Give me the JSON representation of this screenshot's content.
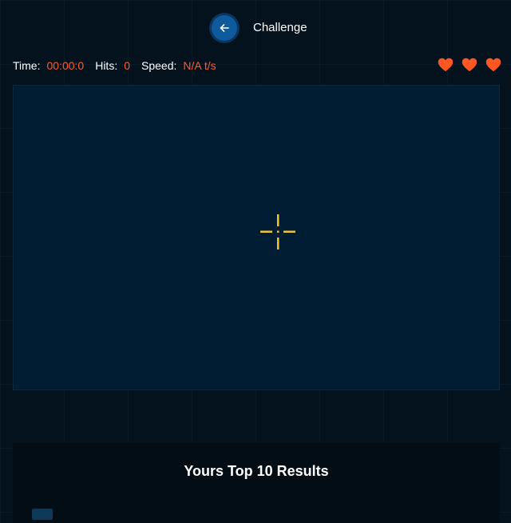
{
  "header": {
    "title": "Challenge",
    "back_icon": "arrow-left-icon"
  },
  "stats": {
    "time_label": "Time:",
    "time_value": "00:00:0",
    "hits_label": "Hits:",
    "hits_value": "0",
    "speed_label": "Speed:",
    "speed_value": "N/A t/s"
  },
  "lives": {
    "count": 3,
    "icon": "heart-icon",
    "color": "#ff5722"
  },
  "play_area": {
    "crosshair_icon": "crosshair-icon",
    "crosshair_color": "#f2c230"
  },
  "results": {
    "title": "Yours Top 10 Results"
  },
  "colors": {
    "accent": "#ff5a30",
    "button": "#0f5a9c",
    "background": "#03121d",
    "play_area": "#011d33"
  }
}
